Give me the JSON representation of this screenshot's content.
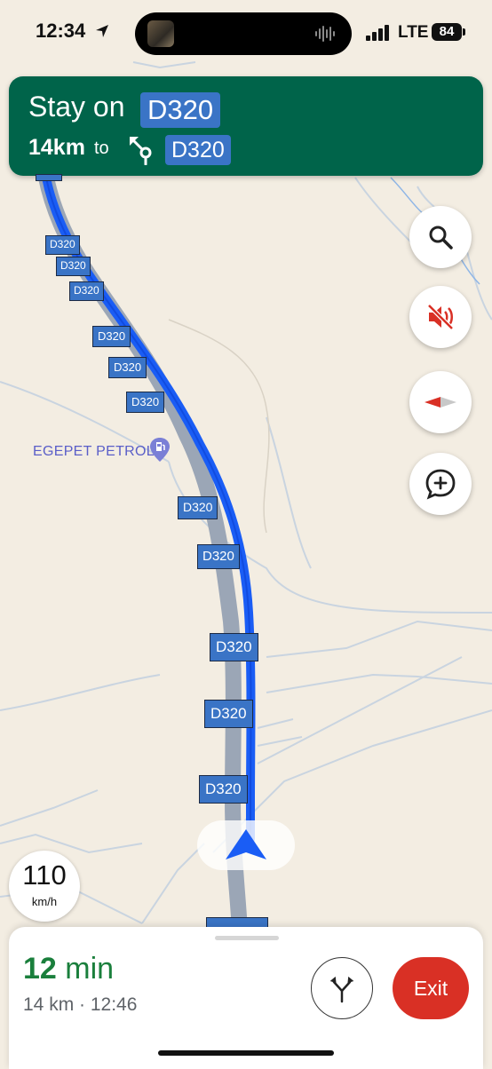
{
  "status_bar": {
    "time": "12:34",
    "network": "LTE",
    "battery": "84"
  },
  "banner": {
    "instruction": "Stay on",
    "road": "D320",
    "distance": "14km",
    "to": "to",
    "next_road": "D320",
    "color": "#00644a"
  },
  "map": {
    "road_shields": [
      "D320",
      "D320",
      "D320",
      "D320",
      "D320",
      "D320",
      "D320",
      "D320",
      "D320",
      "D320",
      "D320",
      "D320"
    ],
    "poi": {
      "name": "EGEPET PETROL",
      "icon": "fuel-station-icon"
    },
    "route_color": "#1a5df5"
  },
  "controls": {
    "search_icon": "search-icon",
    "mute_icon": "volume-off-icon",
    "compass_icon": "compass-icon",
    "report_icon": "add-report-icon"
  },
  "speed": {
    "value": "110",
    "unit": "km/h"
  },
  "trip": {
    "eta_value": "12",
    "eta_unit": "min",
    "details": "14 km · 12:46",
    "exit_label": "Exit",
    "exit_color": "#d93025"
  }
}
